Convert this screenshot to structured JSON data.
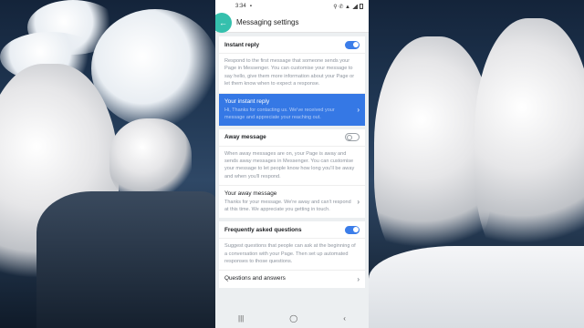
{
  "status_bar": {
    "time": "3:34",
    "indicators": "⚲ ✆ ▲"
  },
  "header": {
    "back_icon": "arrow-left-icon",
    "title": "Messaging settings"
  },
  "sections": [
    {
      "toggle_label": "Instant reply",
      "toggle_on": true,
      "description": "Respond to the first message that someone sends your Page in Messenger. You can customise your message to say hello, give them more information about your Page or let them know when to expect a response.",
      "link": {
        "title": "Your instant reply",
        "subtitle": "Hi, Thanks for contacting us. We've received your message and appreciate your reaching out.",
        "highlighted": true
      }
    },
    {
      "toggle_label": "Away message",
      "toggle_on": false,
      "description": "When away messages are on, your Page is away and sends away messages in Messenger. You can customise your message to let people know how long you'll be away and when you'll respond.",
      "link": {
        "title": "Your away message",
        "subtitle": "Thanks for your message. We're away and can't respond at this time. We appreciate you getting in touch.",
        "highlighted": false
      }
    },
    {
      "toggle_label": "Frequently asked questions",
      "toggle_on": true,
      "description": "Suggest questions that people can ask at the beginning of a conversation with your Page. Then set up automated responses to those questions.",
      "link": {
        "title": "Questions and answers",
        "subtitle": "",
        "highlighted": false
      }
    }
  ],
  "nav_bar": {
    "recents": "|||",
    "home": "◯",
    "back": "‹"
  },
  "colors": {
    "accent": "#3b7de9",
    "highlight_row": "#3578e5",
    "back_button": "#35c0ad"
  }
}
